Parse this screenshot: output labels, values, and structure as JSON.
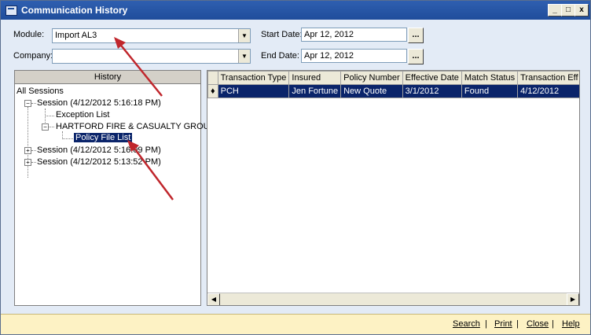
{
  "window": {
    "title": "Communication History",
    "min_label": "_",
    "max_label": "□",
    "close_label": "x"
  },
  "filters": {
    "module_label": "Module:",
    "module_value": "Import AL3",
    "company_label": "Company:",
    "company_value": "",
    "start_date_label": "Start Date:",
    "start_date_value": "Apr 12, 2012",
    "end_date_label": "End Date:",
    "end_date_value": "Apr 12, 2012",
    "picker_label": "..."
  },
  "history": {
    "header": "History",
    "all_sessions": "All Sessions",
    "session1": "Session (4/12/2012 5:16:18 PM)",
    "exception_list": "Exception List",
    "company_group": "HARTFORD FIRE & CASUALTY GROUP",
    "policy_file_list": "Policy File List",
    "session2": "Session (4/12/2012 5:16:09 PM)",
    "session3": "Session (4/12/2012 5:13:52 PM)"
  },
  "grid": {
    "columns": [
      "Transaction Type",
      "Insured",
      "Policy Number",
      "Effective Date",
      "Match Status",
      "Transaction Eff Da"
    ],
    "row": {
      "marker": "♦",
      "transaction_type": "PCH",
      "insured": "Jen Fortune",
      "policy_number": "New Quote",
      "effective_date": "3/1/2012",
      "match_status": "Found",
      "transaction_eff_date": "4/12/2012"
    }
  },
  "footer": {
    "search": "Search",
    "print": "Print",
    "close": "Close",
    "help": "Help",
    "sep": "|"
  },
  "colors": {
    "annotation_arrow": "#c0262c",
    "selection": "#0a246a",
    "footer_bg": "#fdf2c4"
  }
}
